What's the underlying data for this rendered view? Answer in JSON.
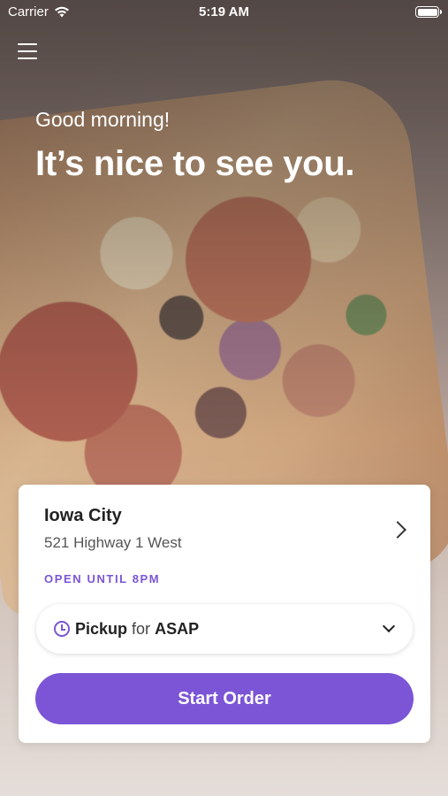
{
  "status_bar": {
    "carrier": "Carrier",
    "time": "5:19 AM"
  },
  "header": {
    "menu_icon": "hamburger-menu-icon"
  },
  "hero": {
    "greeting": "Good morning!",
    "headline": "It’s nice to see you."
  },
  "location": {
    "city": "Iowa City",
    "address": "521 Highway 1 West",
    "hours": "OPEN UNTIL 8PM"
  },
  "order_time": {
    "method": "Pickup",
    "connector": "for",
    "time": "ASAP"
  },
  "actions": {
    "start_order": "Start Order"
  },
  "colors": {
    "accent": "#7b55d6"
  }
}
